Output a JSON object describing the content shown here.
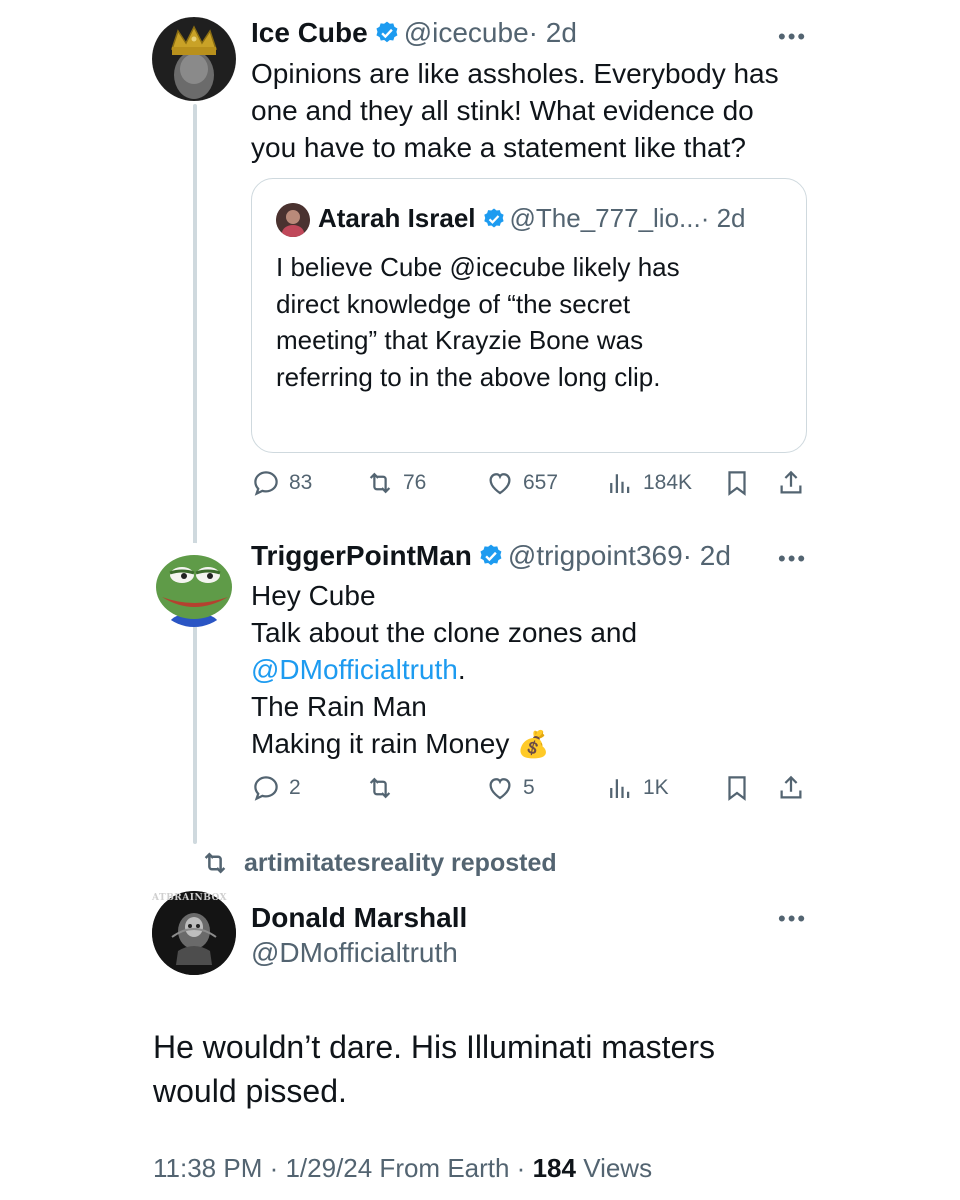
{
  "tweet1": {
    "name": "Ice Cube",
    "handle": "@icecube",
    "time": "· 2d",
    "text_lines": [
      "Opinions are like assholes. Everybody has",
      "one and they all stink! What evidence do",
      "you have to make a statement like that?"
    ],
    "stats": {
      "replies": "83",
      "reposts": "76",
      "likes": "657",
      "views": "184K"
    }
  },
  "quote": {
    "name": "Atarah Israel",
    "handle": "@The_777_lio...",
    "time": "· 2d",
    "text_lines": [
      "I believe Cube @icecube likely has",
      "direct knowledge of “the secret",
      "meeting” that Krayzie Bone was",
      "referring to in the above long clip."
    ]
  },
  "tweet2": {
    "name": "TriggerPointMan",
    "handle": "@trigpoint369",
    "time": "· 2d",
    "line1": "Hey Cube",
    "line2": "Talk about the clone zones and",
    "mention": "@DMofficialtruth",
    "mention_suffix": ".",
    "line4": "The Rain Man",
    "line5": "Making it rain Money",
    "emoji": "💰",
    "stats": {
      "replies": "2",
      "reposts": "",
      "likes": "5",
      "views": "1K"
    }
  },
  "repost_label": "artimitatesreality reposted",
  "tweet3": {
    "name": "Donald Marshall",
    "handle": "@DMofficialtruth",
    "avatar_text": "ATBRAINBOX",
    "text_lines": [
      "He wouldn’t dare. His Illuminati masters",
      "would pissed."
    ],
    "footer_time": "11:38 PM · 1/29/24 From Earth · ",
    "footer_views_count": "184",
    "footer_views_label": " Views"
  },
  "colors": {
    "verified": "#1d9bf0",
    "link": "#1d9bf0",
    "muted": "#536471"
  }
}
